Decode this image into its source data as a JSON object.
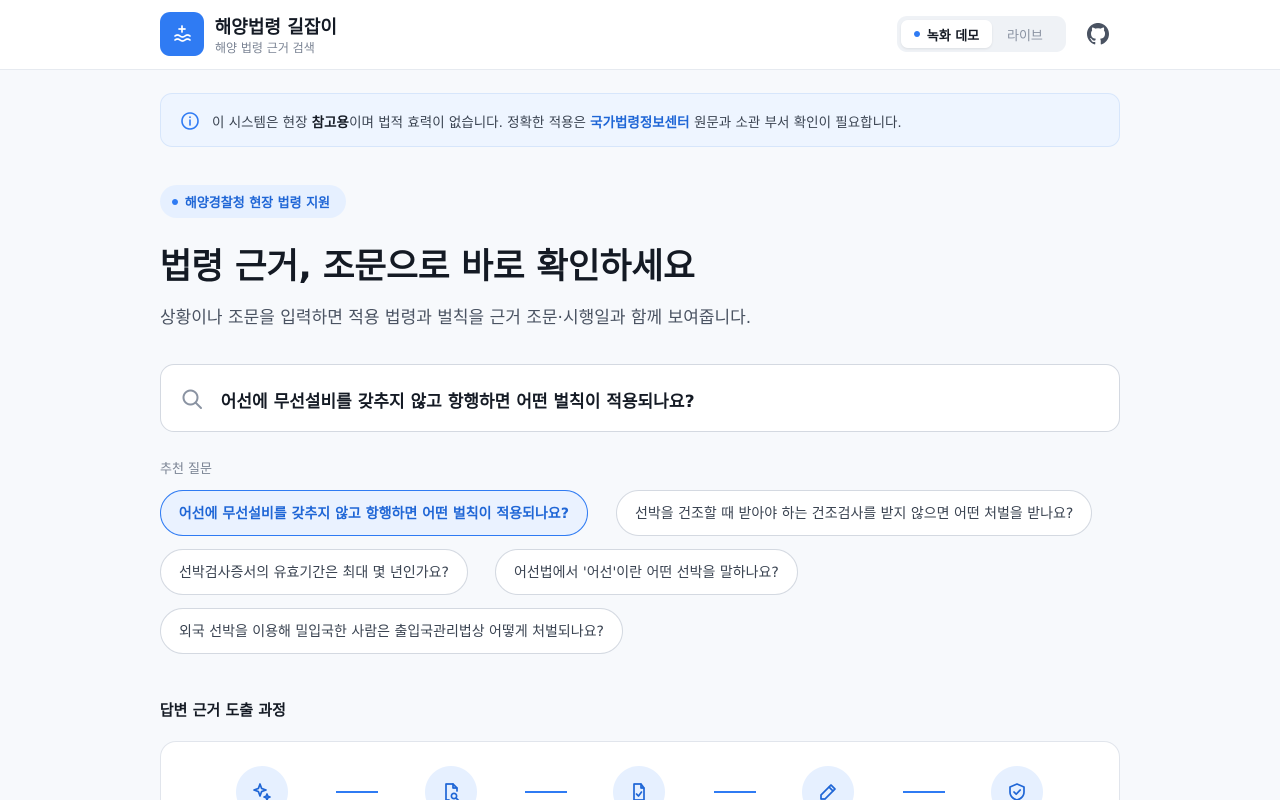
{
  "header": {
    "title": "해양법령 길잡이",
    "subtitle": "해양 법령 근거 검색",
    "mode": {
      "active": "녹화 데모",
      "inactive": "라이브"
    }
  },
  "notice": {
    "part1": "이 시스템은 현장 ",
    "bold": "참고용",
    "part2": "이며 법적 효력이 없습니다. 정확한 적용은 ",
    "link": "국가법령정보센터",
    "part3": " 원문과 소관 부서 확인이 필요합니다."
  },
  "hero": {
    "pill": "해양경찰청 현장 법령 지원",
    "title": "법령 근거, 조문으로 바로 확인하세요",
    "subtitle": "상황이나 조문을 입력하면 적용 법령과 벌칙을 근거 조문·시행일과 함께 보여줍니다."
  },
  "search": {
    "value": "어선에 무선설비를 갖추지 않고 항행하면 어떤 벌칙이 적용되나요?"
  },
  "suggestions": {
    "label": "추천 질문",
    "items": [
      "어선에 무선설비를 갖추지 않고 항행하면 어떤 벌칙이 적용되나요?",
      "선박을 건조할 때 받아야 하는 건조검사를 받지 않으면 어떤 처벌을 받나요?",
      "선박검사증서의 유효기간은 최대 몇 년인가요?",
      "어선법에서 '어선'이란 어떤 선박을 말하나요?",
      "외국 선박을 이용해 밀입국한 사람은 출입국관리법상 어떻게 처벌되나요?"
    ]
  },
  "process": {
    "title": "답변 근거 도출 과정",
    "steps": [
      "sparkle-icon",
      "document-search-icon",
      "document-check-icon",
      "pencil-icon",
      "shield-check-icon"
    ]
  },
  "colors": {
    "accent": "#2f7bf3",
    "accent_text": "#1f66d6",
    "accent_bg": "#e6f0ff"
  }
}
